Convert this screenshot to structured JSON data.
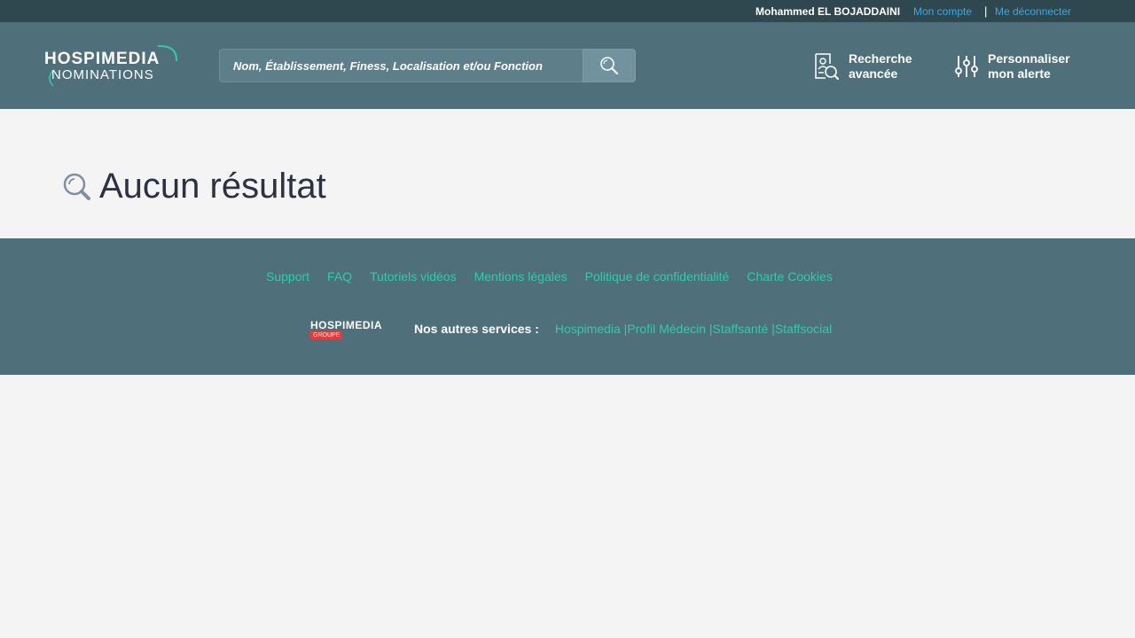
{
  "topbar": {
    "user_name": "Mohammed EL BOJADDAINI",
    "account_link": "Mon compte",
    "separator": "|",
    "logout_link": "Me déconnecter"
  },
  "header": {
    "logo_line1": "HOSPIMEDIA",
    "logo_line2": "NOMINATIONS",
    "search_placeholder": "Nom, Établissement, Finess, Localisation et/ou Fonction",
    "advanced_search_line1": "Recherche",
    "advanced_search_line2": "avancée",
    "alert_line1": "Personnaliser",
    "alert_line2": "mon alerte"
  },
  "main": {
    "result_title": "Aucun résultat"
  },
  "footer": {
    "links": [
      "Support",
      "FAQ",
      "Tutoriels vidéos",
      "Mentions légales",
      "Politique de confidentialité",
      "Charte Cookies"
    ],
    "group_logo_line1": "HOSPIMEDIA",
    "group_logo_line2": "GROUPE",
    "services_label": "Nos autres services :",
    "services": "Hospimedia |Profil Médecin |Staffsanté |Staffsocial"
  },
  "colors": {
    "topbar_bg": "#2f4850",
    "header_bg": "#4f707b",
    "link_blue": "#3aa8e0",
    "footer_link": "#2ecbb0",
    "page_bg": "#f4f4f4"
  },
  "icons": {
    "search_button": "search-icon",
    "advanced_search": "user-search-icon",
    "alert": "sliders-icon",
    "result": "magnifier-icon"
  }
}
